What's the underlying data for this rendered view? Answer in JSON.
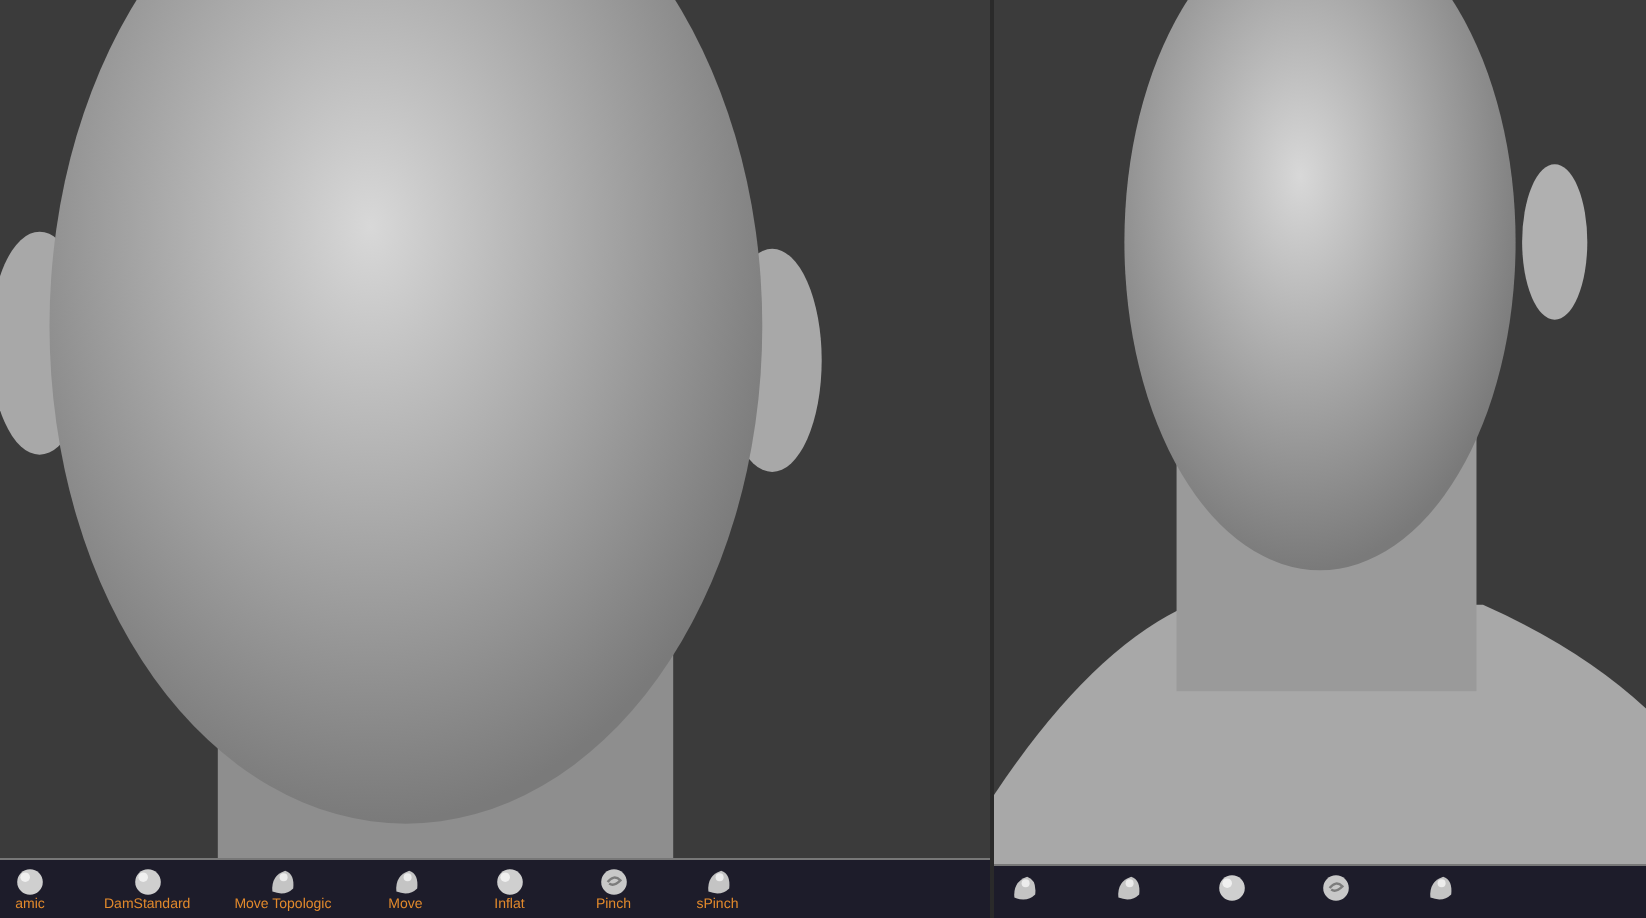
{
  "panels": [
    {
      "brushes": [
        {
          "kind": "sphere",
          "label": "amic"
        },
        {
          "kind": "sphere",
          "label": "DamStandard"
        },
        {
          "kind": "pebble",
          "label": "Move Topologic"
        },
        {
          "kind": "pebble",
          "label": "Move"
        },
        {
          "kind": "sphere",
          "label": "Inflat"
        },
        {
          "kind": "ring",
          "label": "Pinch"
        },
        {
          "kind": "pebble",
          "label": "sPinch"
        }
      ]
    },
    {
      "brushes": [
        {
          "kind": "pebble"
        },
        {
          "kind": "pebble"
        },
        {
          "kind": "sphere"
        },
        {
          "kind": "ring"
        },
        {
          "kind": "pebble"
        }
      ]
    }
  ]
}
